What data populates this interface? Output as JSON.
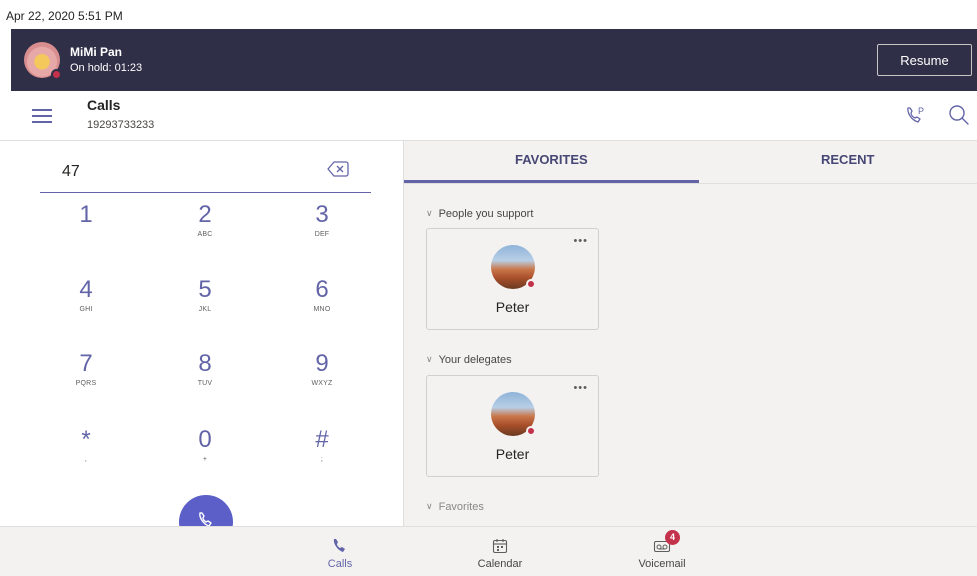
{
  "status_bar": {
    "datetime": "Apr 22, 2020  5:51 PM"
  },
  "hold_bar": {
    "name": "MiMi Pan",
    "status": "On hold: 01:23",
    "resume_label": "Resume"
  },
  "header": {
    "title": "Calls",
    "number": "19293733233"
  },
  "dialpad": {
    "input_value": "47",
    "keys": [
      {
        "digit": "1",
        "letters": ""
      },
      {
        "digit": "2",
        "letters": "ABC"
      },
      {
        "digit": "3",
        "letters": "DEF"
      },
      {
        "digit": "4",
        "letters": "GHI"
      },
      {
        "digit": "5",
        "letters": "JKL"
      },
      {
        "digit": "6",
        "letters": "MNO"
      },
      {
        "digit": "7",
        "letters": "PQRS"
      },
      {
        "digit": "8",
        "letters": "TUV"
      },
      {
        "digit": "9",
        "letters": "WXYZ"
      },
      {
        "digit": "*",
        "letters": ","
      },
      {
        "digit": "0",
        "letters": "+"
      },
      {
        "digit": "#",
        "letters": ";"
      }
    ]
  },
  "tabs": [
    {
      "label": "FAVORITES",
      "active": true
    },
    {
      "label": "RECENT",
      "active": false
    }
  ],
  "sections": [
    {
      "title": "People you support",
      "contact": {
        "name": "Peter",
        "presence": "busy"
      }
    },
    {
      "title": "Your delegates",
      "contact": {
        "name": "Peter",
        "presence": "busy"
      }
    },
    {
      "title": "Favorites"
    }
  ],
  "bottom_nav": [
    {
      "label": "Calls",
      "icon": "phone-icon",
      "active": true
    },
    {
      "label": "Calendar",
      "icon": "calendar-icon",
      "active": false
    },
    {
      "label": "Voicemail",
      "icon": "voicemail-icon",
      "active": false,
      "badge": "4"
    }
  ],
  "colors": {
    "accent": "#6264a7",
    "hold_bar": "#2f2f48",
    "presence_busy": "#c4314b",
    "pane_bg": "#f3f2f1"
  }
}
